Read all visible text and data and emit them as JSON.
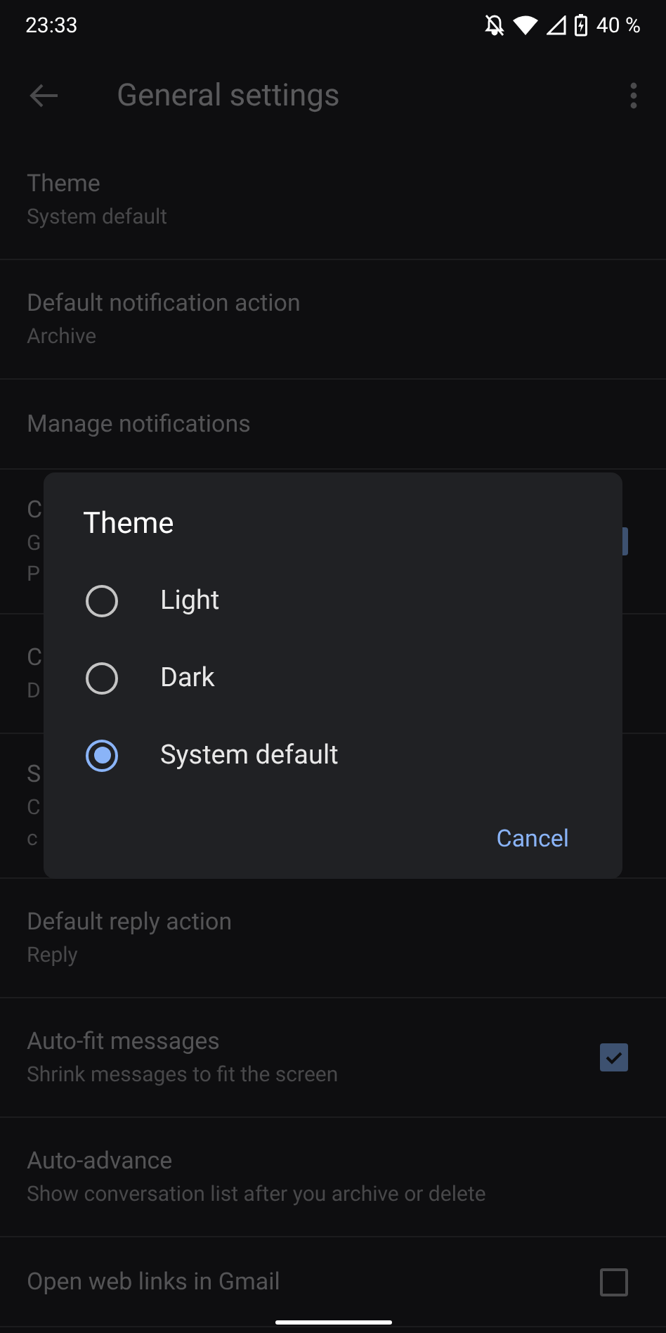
{
  "status_bar": {
    "time": "23:33",
    "battery": "40 %"
  },
  "app_bar": {
    "title": "General settings"
  },
  "settings": [
    {
      "title": "Theme",
      "subtitle": [
        "System default"
      ]
    },
    {
      "title": "Default notification action",
      "subtitle": [
        "Archive"
      ]
    },
    {
      "title": "Manage notifications"
    },
    {
      "title": "C",
      "subtitle": [
        "G",
        "P"
      ],
      "checked": true
    },
    {
      "title": "C",
      "subtitle": [
        "D"
      ]
    },
    {
      "title": "S",
      "subtitle": [
        "C",
        "c"
      ]
    },
    {
      "title": "Default reply action",
      "subtitle": [
        "Reply"
      ]
    },
    {
      "title": "Auto-fit messages",
      "subtitle": [
        "Shrink messages to fit the screen"
      ],
      "checked": true
    },
    {
      "title": "Auto-advance",
      "subtitle": [
        "Show conversation list after you archive or delete"
      ]
    },
    {
      "title": "Open web links in Gmail",
      "checked": false
    }
  ],
  "dialog": {
    "title": "Theme",
    "options": [
      {
        "label": "Light",
        "selected": false
      },
      {
        "label": "Dark",
        "selected": false
      },
      {
        "label": "System default",
        "selected": true
      }
    ],
    "button": "Cancel"
  }
}
